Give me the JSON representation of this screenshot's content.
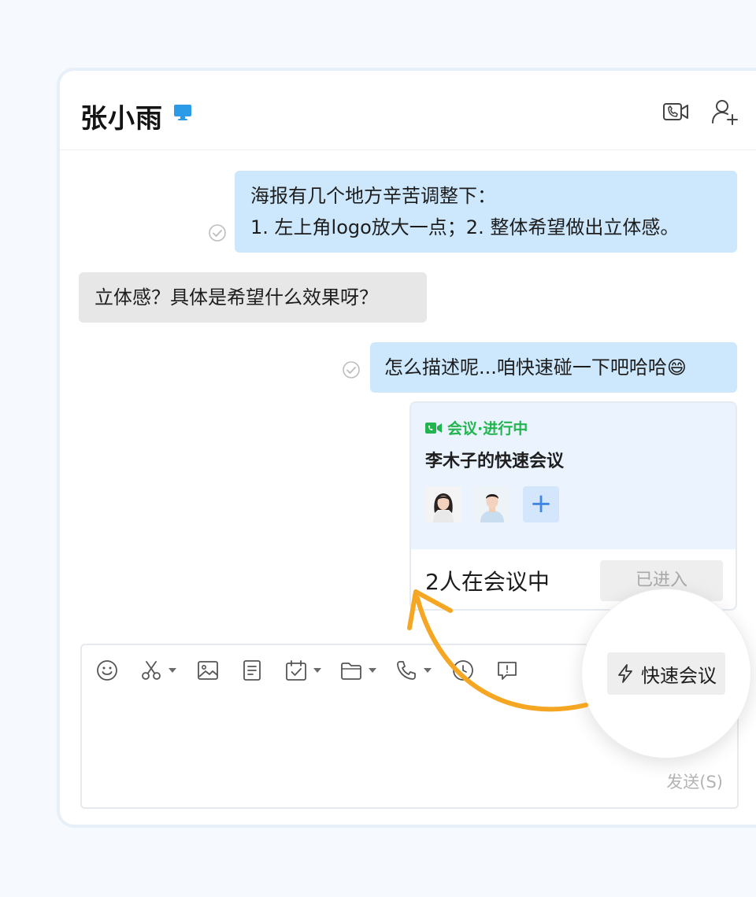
{
  "chat": {
    "contact_name": "张小雨",
    "device_icon": "monitor-icon",
    "header_actions": [
      {
        "name": "video-call",
        "icon": "video-call-icon"
      },
      {
        "name": "add-member",
        "icon": "add-user-icon"
      }
    ]
  },
  "messages": [
    {
      "direction": "out",
      "lines": [
        "海报有几个地方辛苦调整下：",
        "1. 左上角logo放大一点；2. 整体希望做出立体感。"
      ],
      "read": true
    },
    {
      "direction": "in",
      "lines": [
        "立体感？具体是希望什么效果呀？"
      ],
      "read": false
    },
    {
      "direction": "out",
      "lines": [
        "怎么描述呢...咱快速碰一下吧哈哈😄"
      ],
      "read": true
    }
  ],
  "meeting_card": {
    "status": "会议·进行中",
    "title": "李木子的快速会议",
    "participants_text": "2人在会议中",
    "entered_label": "已进入",
    "status_color": "#22b44f"
  },
  "composer": {
    "tools": [
      "emoji-icon",
      "scissors-icon",
      "image-icon",
      "document-icon",
      "calendar-check-icon",
      "folder-icon",
      "phone-icon",
      "clock-icon",
      "feedback-icon"
    ],
    "send_label": "发送(S)"
  },
  "quick_meeting": {
    "label": "快速会议",
    "icon": "lightning-icon"
  },
  "colors": {
    "outgoing_bubble": "#cde8fd",
    "incoming_bubble": "#e7e7e7",
    "arrow": "#f5a623",
    "accent_blue": "#3f86e6"
  }
}
